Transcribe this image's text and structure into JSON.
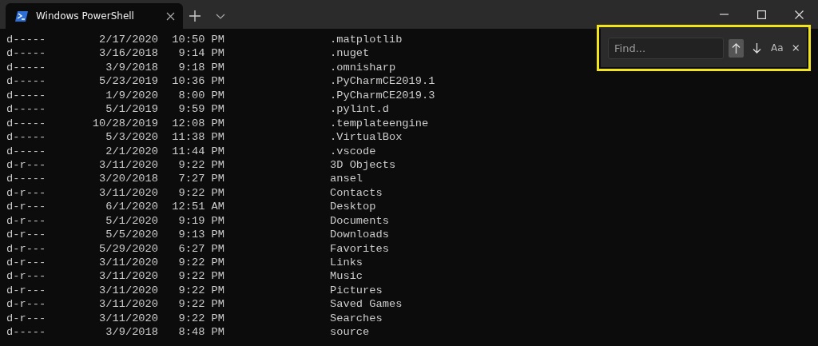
{
  "tabs": [
    {
      "title": "Windows PowerShell",
      "selected": true
    }
  ],
  "find": {
    "placeholder": "Find...",
    "nav": [
      {
        "kind": "up",
        "selected": true
      },
      {
        "kind": "down",
        "selected": false
      }
    ],
    "case_label": "Aa",
    "highlighted": true
  },
  "rows": [
    {
      "mode": "d-----",
      "date": "2/17/2020",
      "time": "10:50 PM",
      "name": ".matplotlib"
    },
    {
      "mode": "d-----",
      "date": "3/16/2018",
      "time": "9:14 PM",
      "name": ".nuget"
    },
    {
      "mode": "d-----",
      "date": "3/9/2018",
      "time": "9:18 PM",
      "name": ".omnisharp"
    },
    {
      "mode": "d-----",
      "date": "5/23/2019",
      "time": "10:36 PM",
      "name": ".PyCharmCE2019.1"
    },
    {
      "mode": "d-----",
      "date": "1/9/2020",
      "time": "8:00 PM",
      "name": ".PyCharmCE2019.3"
    },
    {
      "mode": "d-----",
      "date": "5/1/2019",
      "time": "9:59 PM",
      "name": ".pylint.d"
    },
    {
      "mode": "d-----",
      "date": "10/28/2019",
      "time": "12:08 PM",
      "name": ".templateengine"
    },
    {
      "mode": "d-----",
      "date": "5/3/2020",
      "time": "11:38 PM",
      "name": ".VirtualBox"
    },
    {
      "mode": "d-----",
      "date": "2/1/2020",
      "time": "11:44 PM",
      "name": ".vscode"
    },
    {
      "mode": "d-r---",
      "date": "3/11/2020",
      "time": "9:22 PM",
      "name": "3D Objects"
    },
    {
      "mode": "d-----",
      "date": "3/20/2018",
      "time": "7:27 PM",
      "name": "ansel"
    },
    {
      "mode": "d-r---",
      "date": "3/11/2020",
      "time": "9:22 PM",
      "name": "Contacts"
    },
    {
      "mode": "d-r---",
      "date": "6/1/2020",
      "time": "12:51 AM",
      "name": "Desktop"
    },
    {
      "mode": "d-r---",
      "date": "5/1/2020",
      "time": "9:19 PM",
      "name": "Documents"
    },
    {
      "mode": "d-r---",
      "date": "5/5/2020",
      "time": "9:13 PM",
      "name": "Downloads"
    },
    {
      "mode": "d-r---",
      "date": "5/29/2020",
      "time": "6:27 PM",
      "name": "Favorites"
    },
    {
      "mode": "d-r---",
      "date": "3/11/2020",
      "time": "9:22 PM",
      "name": "Links"
    },
    {
      "mode": "d-r---",
      "date": "3/11/2020",
      "time": "9:22 PM",
      "name": "Music"
    },
    {
      "mode": "d-r---",
      "date": "3/11/2020",
      "time": "9:22 PM",
      "name": "Pictures"
    },
    {
      "mode": "d-r---",
      "date": "3/11/2020",
      "time": "9:22 PM",
      "name": "Saved Games"
    },
    {
      "mode": "d-r---",
      "date": "3/11/2020",
      "time": "9:22 PM",
      "name": "Searches"
    },
    {
      "mode": "d-----",
      "date": "3/9/2018",
      "time": "8:48 PM",
      "name": "source"
    }
  ]
}
